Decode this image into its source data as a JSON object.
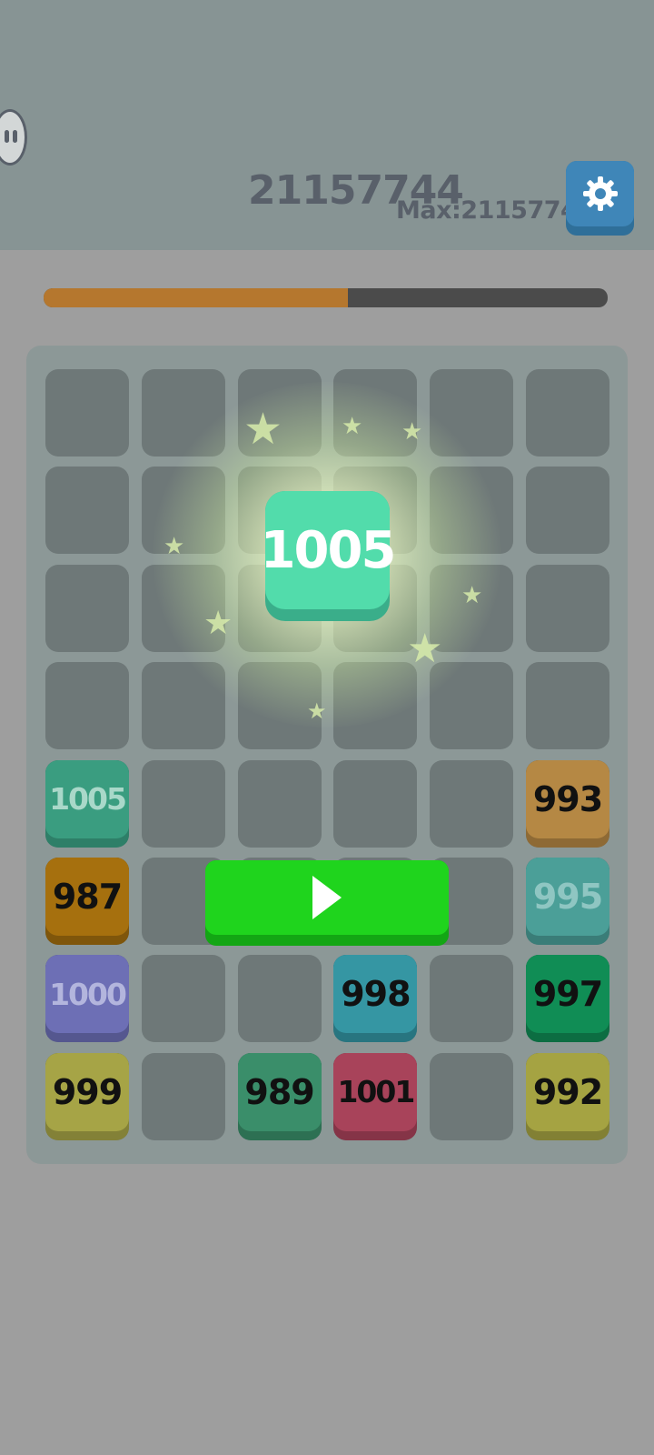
{
  "header": {
    "score": "21157744",
    "max_score": "Max:21157744"
  },
  "progress": {
    "fraction": 0.54,
    "fill_color": "#b5772e",
    "track_color": "#4b4b4b"
  },
  "merge_tile": {
    "value": "1005",
    "color": "#52dcab"
  },
  "board": {
    "rows": 8,
    "cols": 6,
    "tiles": [
      {
        "row": 4,
        "col": 0,
        "value": "1005",
        "face": "#3a9d80",
        "shade": "#2e7f68",
        "text": "#a9d8c9"
      },
      {
        "row": 4,
        "col": 5,
        "value": "993",
        "face": "#b58844",
        "shade": "#8e6a35",
        "text": "#111111"
      },
      {
        "row": 5,
        "col": 0,
        "value": "987",
        "face": "#a6700e",
        "shade": "#7f560b",
        "text": "#111111"
      },
      {
        "row": 5,
        "col": 5,
        "value": "995",
        "face": "#4b9f98",
        "shade": "#3a7d78",
        "text": "#8fc6c2"
      },
      {
        "row": 6,
        "col": 0,
        "value": "1000",
        "face": "#6d6fb5",
        "shade": "#55578f",
        "text": "#b3b5dd"
      },
      {
        "row": 6,
        "col": 3,
        "value": "998",
        "face": "#3596a3",
        "shade": "#287580",
        "text": "#111111"
      },
      {
        "row": 6,
        "col": 5,
        "value": "997",
        "face": "#108d55",
        "shade": "#0c6d42",
        "text": "#111111"
      },
      {
        "row": 7,
        "col": 0,
        "value": "999",
        "face": "#a6a446",
        "shade": "#838137",
        "text": "#111111"
      },
      {
        "row": 7,
        "col": 2,
        "value": "989",
        "face": "#3a8e6a",
        "shade": "#2d7053",
        "text": "#111111"
      },
      {
        "row": 7,
        "col": 3,
        "value": "1001",
        "face": "#a8435a",
        "shade": "#853447",
        "text": "#111111"
      },
      {
        "row": 7,
        "col": 5,
        "value": "992",
        "face": "#a5a342",
        "shade": "#828034",
        "text": "#111111"
      }
    ]
  },
  "icons": {
    "settings": "gear-icon",
    "play": "play-icon",
    "assistant": "bot-icon"
  }
}
